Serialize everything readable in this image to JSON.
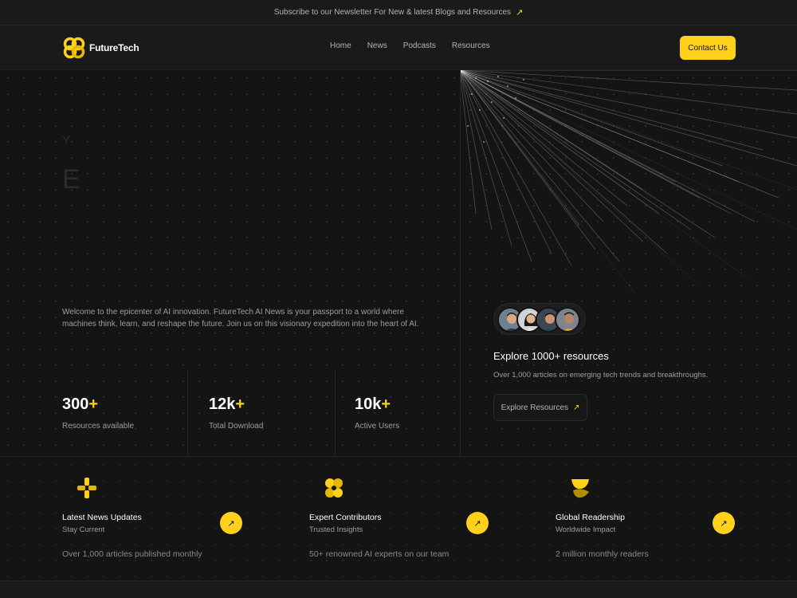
{
  "banner": {
    "text": "Subscribe to our Newsletter For New & latest Blogs and Resources",
    "arrow": "↗"
  },
  "nav": {
    "logo_text": "FutureTech",
    "links": [
      "Home",
      "News",
      "Podcasts",
      "Resources"
    ],
    "cta": "Contact Us"
  },
  "hero": {
    "ghost_letter_1": "Y",
    "ghost_letter_2": "E",
    "intro": "Welcome to the epicenter of AI innovation. FutureTech AI News is your passport to a world where machines think, learn, and reshape the future. Join us on this visionary expedition into the heart of AI.",
    "stats": [
      {
        "value": "300",
        "plus": "+",
        "label": "Resources available"
      },
      {
        "value": "12k",
        "plus": "+",
        "label": "Total Download"
      },
      {
        "value": "10k",
        "plus": "+",
        "label": "Active Users"
      }
    ],
    "explore": {
      "title": "Explore 1000+ resources",
      "subtitle": "Over 1,000 articles on emerging tech trends and breakthroughs.",
      "button": "Explore Resources",
      "arrow": "↗"
    }
  },
  "features": [
    {
      "title": "Latest News Updates",
      "subtitle": "Stay Current",
      "description": "Over 1,000 articles published monthly",
      "icon": "sparkle-icon"
    },
    {
      "title": "Expert Contributors",
      "subtitle": "Trusted Insights",
      "description": "50+ renowned AI experts on our team",
      "icon": "clover-icon"
    },
    {
      "title": "Global Readership",
      "subtitle": "Worldwide Impact",
      "description": "2 million monthly readers",
      "icon": "leaf-icon"
    }
  ],
  "colors": {
    "accent": "#ffd11a",
    "background": "#141414",
    "panel": "#1a1a1a"
  }
}
